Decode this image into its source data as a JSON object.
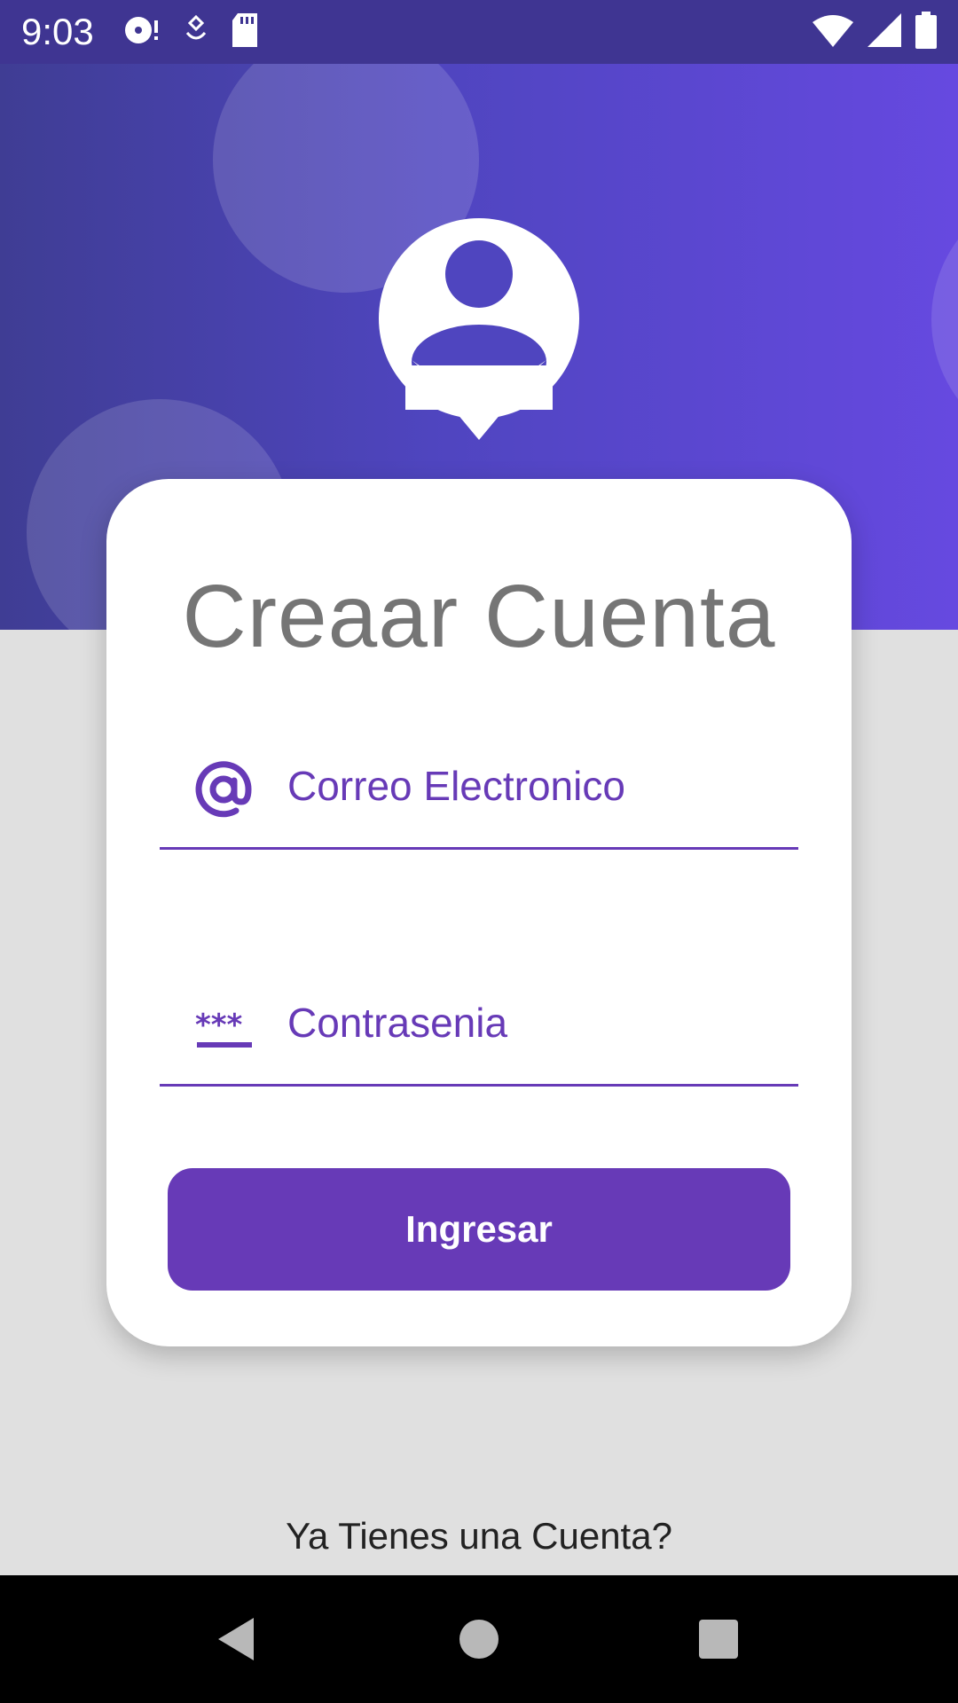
{
  "status_bar": {
    "time": "9:03",
    "icons_left": [
      "media-icon",
      "assistant-icon",
      "sd-card-icon"
    ],
    "icons_right": [
      "wifi-icon",
      "signal-icon",
      "battery-icon"
    ]
  },
  "colors": {
    "accent": "#673ab7",
    "header_gradient_start": "#3f3d94",
    "header_gradient_end": "#6649e0",
    "title_gray": "#757575",
    "background": "#e0e0e0"
  },
  "avatar": {
    "icon": "user-avatar-icon"
  },
  "card": {
    "title": "Creaar Cuenta",
    "email": {
      "icon": "at-sign-icon",
      "placeholder": "Correo Electronico",
      "value": ""
    },
    "password": {
      "icon": "password-icon",
      "placeholder": "Contrasenia",
      "value": ""
    },
    "submit_label": "Ingresar"
  },
  "footer": {
    "already_account": "Ya Tienes una Cuenta?"
  },
  "nav_bar": {
    "buttons": [
      "back-icon",
      "home-icon",
      "recents-icon"
    ]
  }
}
